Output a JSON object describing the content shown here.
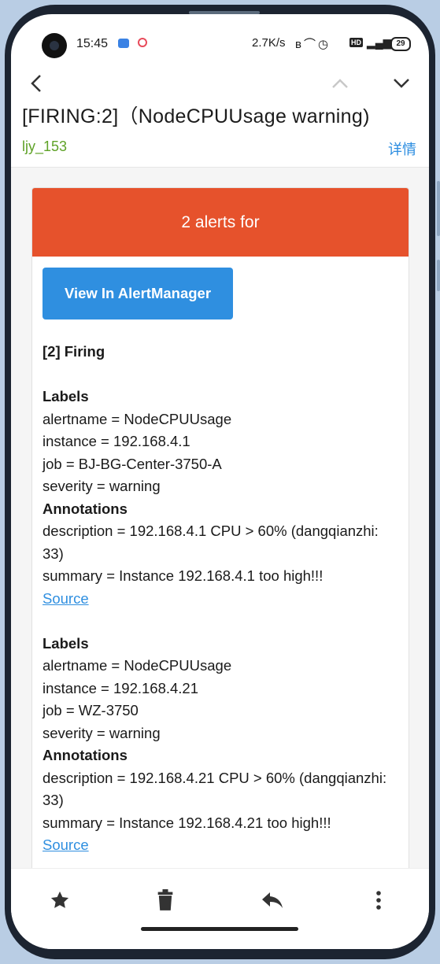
{
  "status_bar": {
    "time": "15:45",
    "net_speed": "2.7K/s",
    "battery": "29",
    "hd_label": "HD"
  },
  "message": {
    "subject": "[FIRING:2]（NodeCPUUsage warning)",
    "sender": "ljy_153",
    "details_link": "详情"
  },
  "email": {
    "banner": "2 alerts for",
    "button_label": "View In AlertManager",
    "firing_heading": "[2] Firing",
    "alerts": [
      {
        "labels_heading": "Labels",
        "alertname": "alertname = NodeCPUUsage",
        "instance": "instance = 192.168.4.1",
        "job": "job = BJ-BG-Center-3750-A",
        "severity": "severity = warning",
        "annotations_heading": "Annotations",
        "description_line1": "description = 192.168.4.1 CPU > 60% (dangqianzhi:",
        "description_line2": "33)",
        "summary": "summary = Instance 192.168.4.1 too high!!!",
        "source_link": "Source"
      },
      {
        "labels_heading": "Labels",
        "alertname": "alertname = NodeCPUUsage",
        "instance": "instance = 192.168.4.21",
        "job": "job = WZ-3750",
        "severity": "severity = warning",
        "annotations_heading": "Annotations",
        "description_line1": "description = 192.168.4.21 CPU > 60% (dangqianzhi:",
        "description_line2": "33)",
        "summary": "summary = Instance 192.168.4.21 too high!!!",
        "source_link": "Source"
      }
    ]
  },
  "icons": {
    "back": "chevron-left-icon",
    "prev": "chevron-up-icon",
    "next": "chevron-down-icon",
    "star": "star-icon",
    "delete": "trash-icon",
    "reply": "reply-icon",
    "more": "more-vertical-icon"
  },
  "colors": {
    "banner": "#e6522c",
    "button": "#2f8fe0",
    "sender": "#5fa227",
    "link": "#2a8ce0"
  }
}
